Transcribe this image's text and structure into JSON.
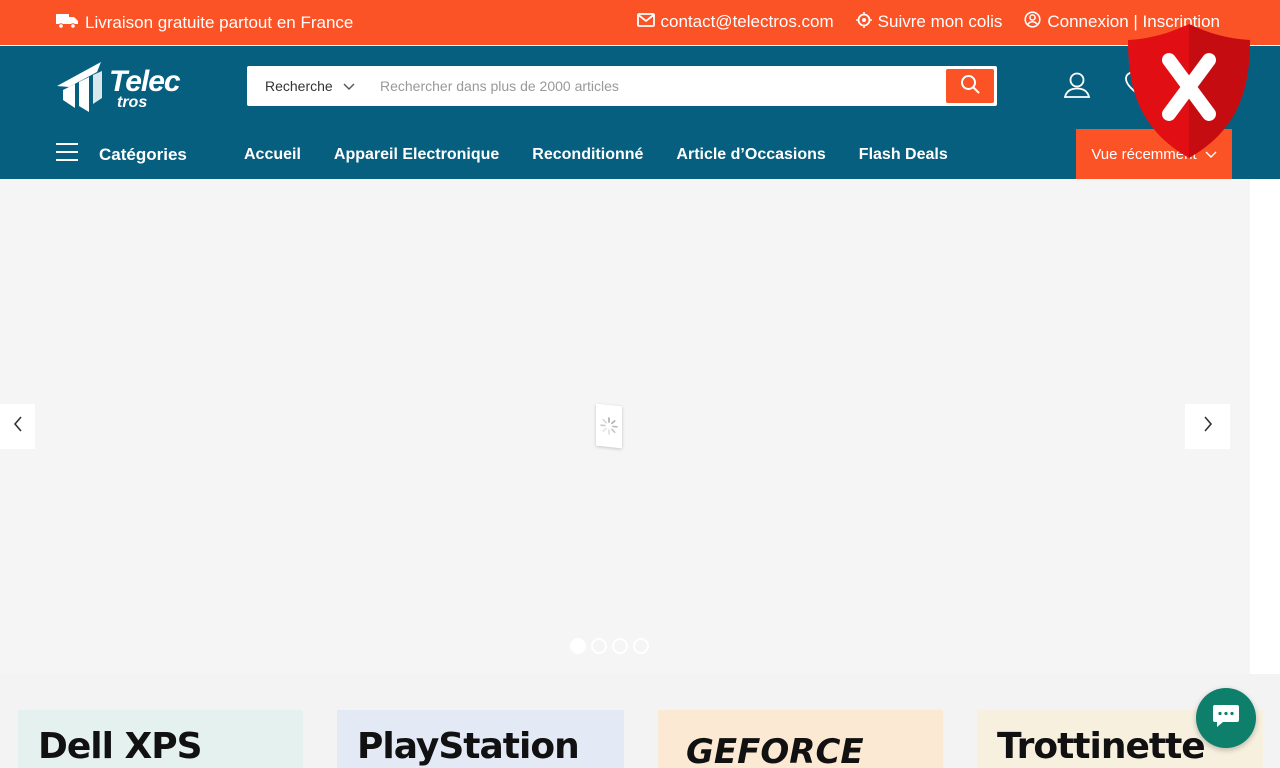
{
  "topbar": {
    "shipping_text": "Livraison gratuite partout en France",
    "email": "contact@telectros.com",
    "track_text": "Suivre mon colis",
    "auth_text": "Connexion | Inscription"
  },
  "logo": {
    "line1": "Telec",
    "line2": "tros"
  },
  "search": {
    "category_label": "Recherche",
    "placeholder": "Rechercher dans plus de 2000 articles"
  },
  "nav": {
    "categories_label": "Catégories",
    "links": [
      "Accueil",
      "Appareil Electronique",
      "Reconditionné",
      "Article d’Occasions",
      "Flash Deals"
    ],
    "recent_label": "Vue récemment"
  },
  "slider": {
    "dot_count": 4,
    "active_dot": 1
  },
  "cards": [
    "Dell XPS",
    "PlayStation",
    "GEFORCE",
    "Trottinette"
  ],
  "colors": {
    "accent": "#fb5226",
    "header": "#075f80",
    "chat": "#0e7f6a",
    "shield": "#e10f14"
  },
  "icons": {
    "shipping": "truck-icon",
    "email": "envelope-icon",
    "track": "location-icon",
    "auth": "user-circle-icon",
    "menu": "hamburger-icon",
    "search": "search-icon",
    "user": "user-icon",
    "wishlist": "heart-icon",
    "chat": "chat-bubble-icon",
    "shield": "shield-x-icon"
  }
}
